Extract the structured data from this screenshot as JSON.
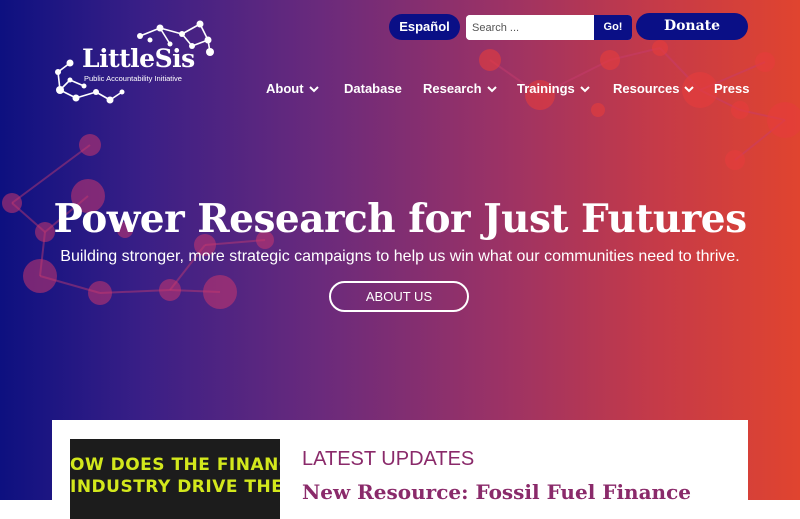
{
  "brand": {
    "name": "LittleSis",
    "tagline": "Public Accountability Initiative",
    "colors": {
      "navy": "#0a0f86",
      "accent": "#8a2a6a",
      "thumb_text": "#d3e81c"
    }
  },
  "header": {
    "language_button": "Español",
    "search": {
      "placeholder": "Search ...",
      "submit_label": "Go!"
    },
    "donate_label": "Donate"
  },
  "nav": {
    "items": [
      {
        "label": "About",
        "has_dropdown": true
      },
      {
        "label": "Database",
        "has_dropdown": false
      },
      {
        "label": "Research",
        "has_dropdown": true
      },
      {
        "label": "Trainings",
        "has_dropdown": true
      },
      {
        "label": "Resources",
        "has_dropdown": true
      },
      {
        "label": "Press",
        "has_dropdown": false
      }
    ],
    "dropdown_icon": "chevron-down-icon"
  },
  "hero": {
    "headline": "Power Research for Just Futures",
    "subheadline": "Building stronger, more strategic campaigns to help us win what our communities need to thrive.",
    "cta_label": "ABOUT US"
  },
  "latest": {
    "section_label": "LATEST UPDATES",
    "featured_title": "New Resource: Fossil Fuel Finance",
    "thumbnail_lines": [
      "OW DOES THE FINANC",
      "INDUSTRY DRIVE THE"
    ]
  }
}
